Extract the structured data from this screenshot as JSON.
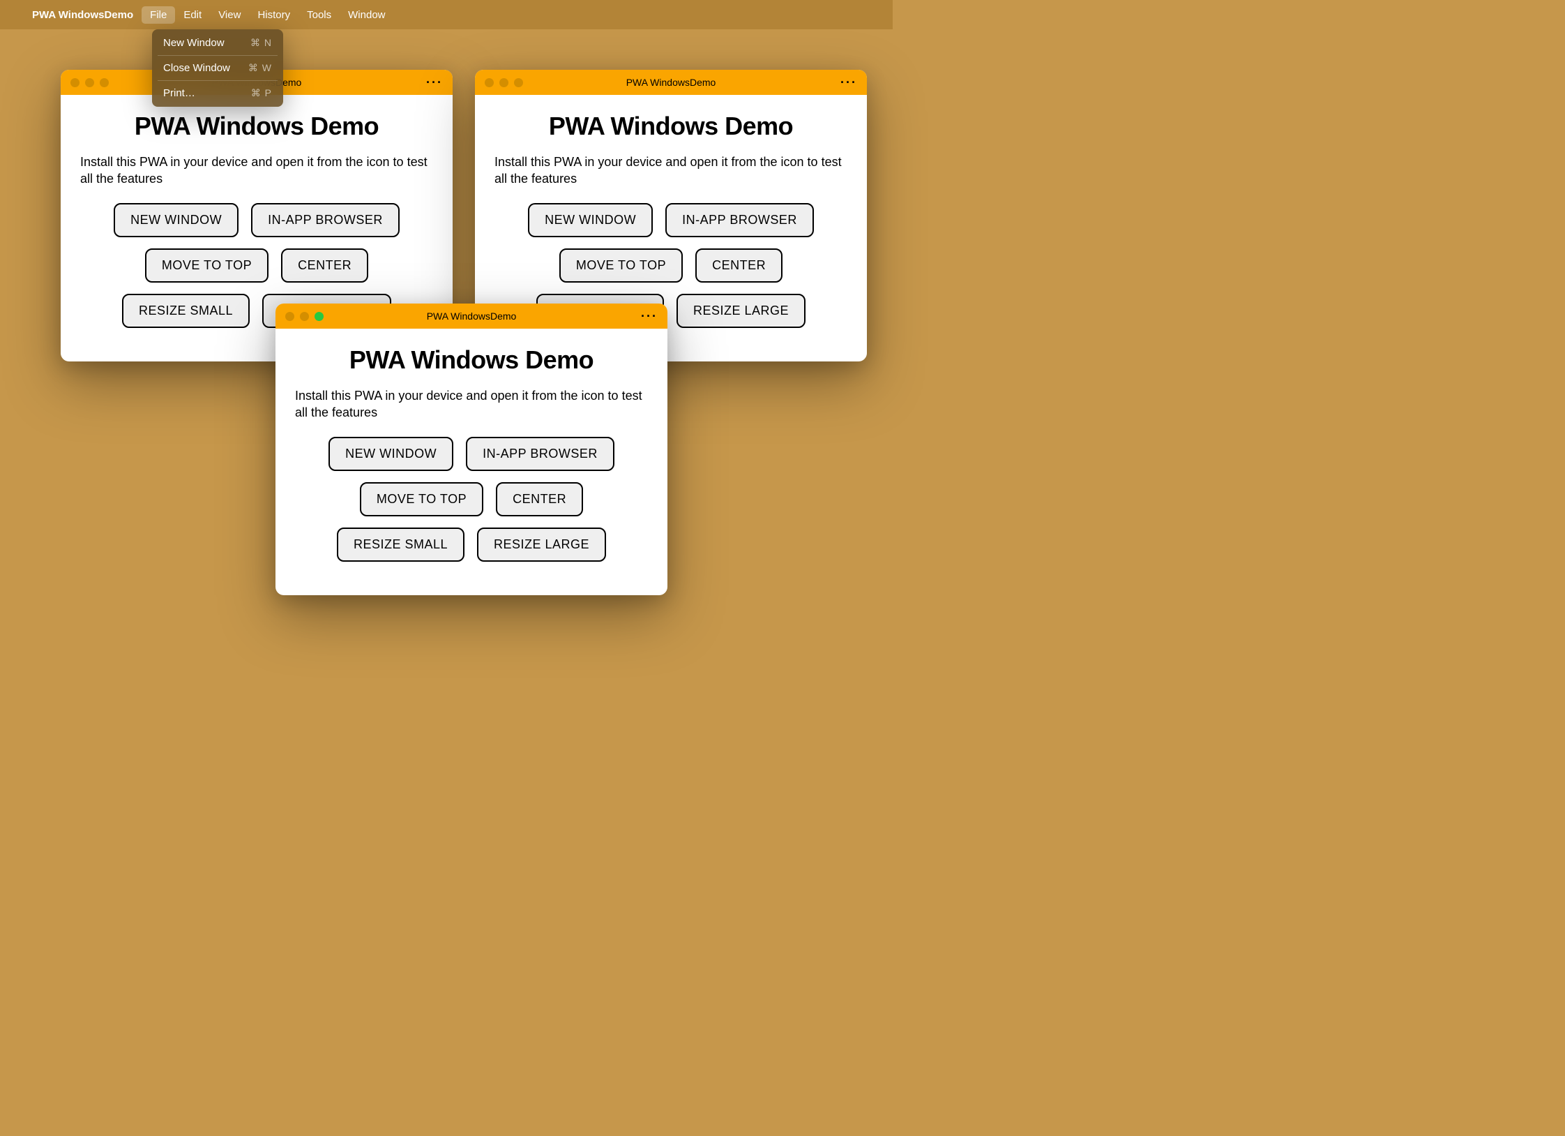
{
  "menubar": {
    "app_name": "PWA WindowsDemo",
    "items": [
      "File",
      "Edit",
      "View",
      "History",
      "Tools",
      "Window"
    ]
  },
  "file_menu": {
    "items": [
      {
        "label": "New Window",
        "shortcut": "⌘ N"
      },
      {
        "label": "Close Window",
        "shortcut": "⌘ W"
      },
      {
        "label": "Print…",
        "shortcut": "⌘ P"
      }
    ]
  },
  "window": {
    "titlebar_title": "PWA WindowsDemo",
    "more_icon": "···",
    "heading": "PWA Windows Demo",
    "description": "Install this PWA in your device and open it from the icon to test all the features",
    "buttons": {
      "new_window": "NEW WINDOW",
      "in_app_browser": "IN-APP BROWSER",
      "move_to_top": "MOVE TO TOP",
      "center": "CENTER",
      "resize_small": "RESIZE SMALL",
      "resize_large": "RESIZE LARGE"
    }
  }
}
